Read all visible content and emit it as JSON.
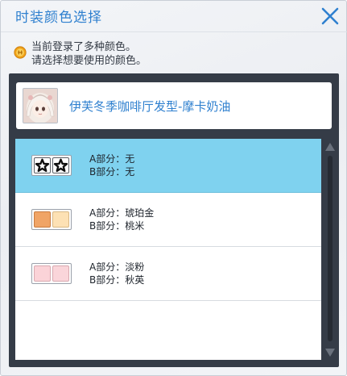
{
  "dialog": {
    "title": "时装颜色选择",
    "close_icon": "close-icon",
    "accent_color": "#2f80cf"
  },
  "notice": {
    "icon": "coin-icon",
    "line1": "当前登录了多种颜色。",
    "line2": "请选择想要使用的颜色。"
  },
  "item": {
    "name": "伊芙冬季咖啡厅发型-摩卡奶油",
    "avatar_icon": "character-portrait"
  },
  "color_options": [
    {
      "part_a_label": "A部分：",
      "part_a_value": "无",
      "part_b_label": "B部分：",
      "part_b_value": "无",
      "swatch_a": "none",
      "swatch_b": "none",
      "selected": true,
      "highlight_color": "#7fd2ef"
    },
    {
      "part_a_label": "A部分：",
      "part_a_value": "琥珀金",
      "part_b_label": "B部分：",
      "part_b_value": "桃米",
      "swatch_a": "#f0a466",
      "swatch_b": "#fde1b4",
      "selected": false
    },
    {
      "part_a_label": "A部分：",
      "part_a_value": "淡粉",
      "part_b_label": "B部分：",
      "part_b_value": "秋英",
      "swatch_a": "#fbd3d8",
      "swatch_b": "#fad5da",
      "selected": false
    }
  ],
  "scrollbar": {
    "up_icon": "triangle-up-icon",
    "down_icon": "triangle-down-icon"
  }
}
